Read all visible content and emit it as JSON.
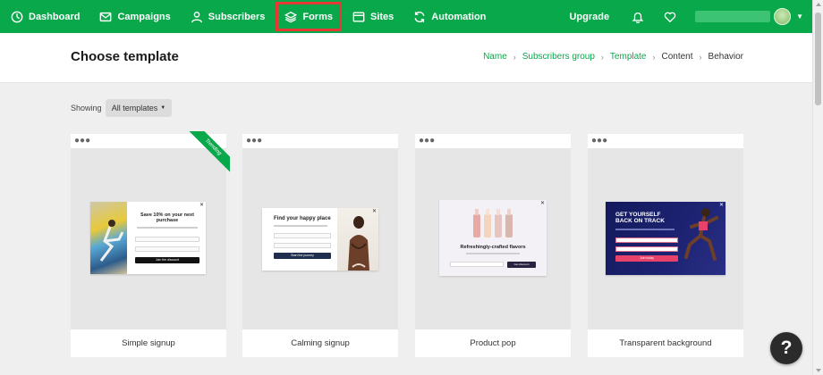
{
  "nav": {
    "items": [
      {
        "label": "Dashboard",
        "icon": "dashboard-icon"
      },
      {
        "label": "Campaigns",
        "icon": "envelope-icon"
      },
      {
        "label": "Subscribers",
        "icon": "user-icon"
      },
      {
        "label": "Forms",
        "icon": "layers-icon",
        "highlighted": true
      },
      {
        "label": "Sites",
        "icon": "browser-icon"
      },
      {
        "label": "Automation",
        "icon": "refresh-icon"
      }
    ],
    "upgrade_label": "Upgrade",
    "highlight_color": "#e53935",
    "brand_color": "#09a84b"
  },
  "header": {
    "title": "Choose template",
    "breadcrumb": [
      "Name",
      "Subscribers group",
      "Template",
      "Content",
      "Behavior"
    ]
  },
  "filter": {
    "showing_label": "Showing",
    "selected": "All templates"
  },
  "templates": [
    {
      "name": "Simple signup",
      "badge": "Trending",
      "preview": {
        "heading": "Save 10% on your next purchase",
        "button": "Join the discount"
      }
    },
    {
      "name": "Calming signup",
      "preview": {
        "heading": "Find your happy place",
        "button": "Start the journey"
      }
    },
    {
      "name": "Product pop",
      "preview": {
        "heading": "Refreshingly-crafted flavors",
        "button": "Get discount"
      }
    },
    {
      "name": "Transparent background",
      "preview": {
        "heading": "GET YOURSELF BACK ON TRACK",
        "button": "Join today"
      }
    }
  ],
  "help_label": "?"
}
